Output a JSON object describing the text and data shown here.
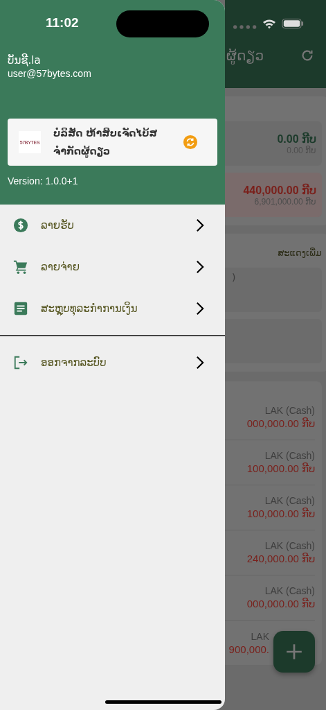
{
  "status_bar": {
    "time": "11:02"
  },
  "drawer": {
    "app_name": "ບັນຊີ.la",
    "email": "user@57bytes.com",
    "company": {
      "logo_text": "57BYTES",
      "name": "ບໍລິສັດ ຫ້າສິບເຈັດໄບ້ສ ຈຳກັດຜູ້ດຽວ"
    },
    "version": "Version: 1.0.0+1",
    "items": [
      {
        "label": "ລາຍຮັບ",
        "kind": "income"
      },
      {
        "label": "ລາຍຈ່າຍ",
        "kind": "expense"
      },
      {
        "label": "ສະຫຼຸບທຸລະກຳການເງິນ",
        "kind": "report"
      }
    ],
    "footer_items": [
      {
        "label": "ອອກຈາກລະບົບ",
        "kind": "logout"
      }
    ]
  },
  "background": {
    "title": "ຜູ້ດຽວ",
    "summary": [
      {
        "amount": "0.00 ກີບ",
        "sub": "0.00 ກີບ",
        "kind": "positive"
      },
      {
        "amount": "440,000.00 ກີບ",
        "sub": "6,901,000.00 ກີບ",
        "kind": "negative"
      }
    ],
    "show_more": "ສະແດງເພີ່ມ",
    "cut_text": ")",
    "rows": [
      {
        "account": "LAK (Cash)",
        "amount": "000,000.00 ກີບ"
      },
      {
        "account": "LAK (Cash)",
        "amount": "100,000.00 ກີບ"
      },
      {
        "account": "LAK (Cash)",
        "amount": "100,000.00 ກີບ"
      },
      {
        "account": "LAK (Cash)",
        "amount": "240,000.00 ກີບ"
      },
      {
        "account": "LAK (Cash)",
        "amount": "000,000.00 ກີບ"
      },
      {
        "account": "LAK",
        "amount": "900,000."
      }
    ]
  }
}
